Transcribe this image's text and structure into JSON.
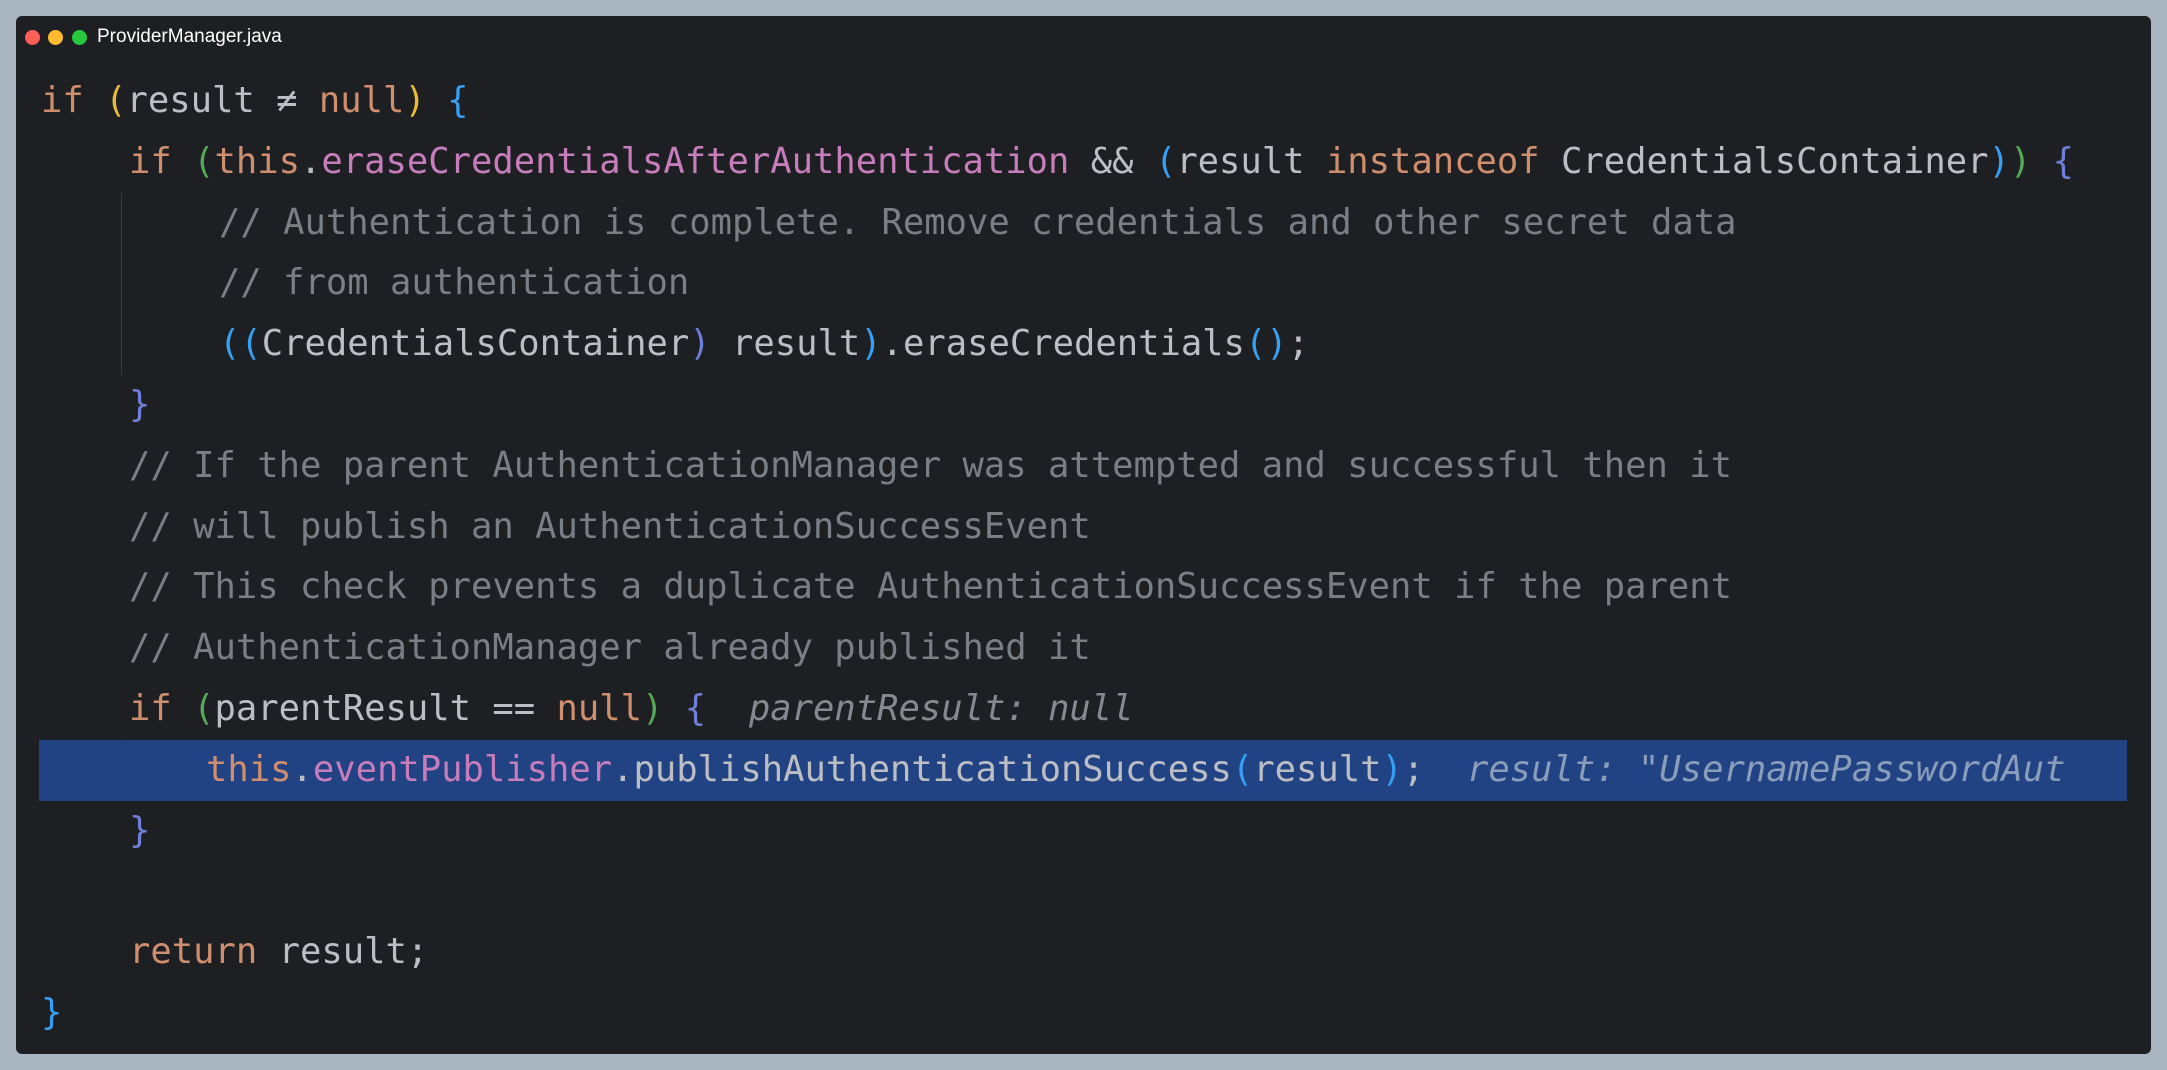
{
  "window": {
    "title": "ProviderManager.java",
    "traffic_lights": [
      "close",
      "minimize",
      "zoom"
    ]
  },
  "code": {
    "lines": [
      "if (result ≠ null) {",
      "    if (this.eraseCredentialsAfterAuthentication && (result instanceof CredentialsContainer)) {",
      "        // Authentication is complete. Remove credentials and other secret data",
      "        // from authentication",
      "        ((CredentialsContainer) result).eraseCredentials();",
      "    }",
      "    // If the parent AuthenticationManager was attempted and successful then it",
      "    // will publish an AuthenticationSuccessEvent",
      "    // This check prevents a duplicate AuthenticationSuccessEvent if the parent",
      "    // AuthenticationManager already published it",
      "    if (parentResult == null) {",
      "        this.eventPublisher.publishAuthenticationSuccess(result);",
      "    }",
      "",
      "    return result;",
      "}"
    ],
    "inline_hints": {
      "parent_result": "parentResult: null",
      "result": "result: \"UsernamePasswordAut"
    },
    "selected_line": 12,
    "colors": {
      "background": "#1e1f22",
      "selection": "#214283",
      "keyword": "#cf8e6d",
      "field": "#c77dbb",
      "comment": "#7a7e85",
      "text": "#bcbec4"
    }
  }
}
